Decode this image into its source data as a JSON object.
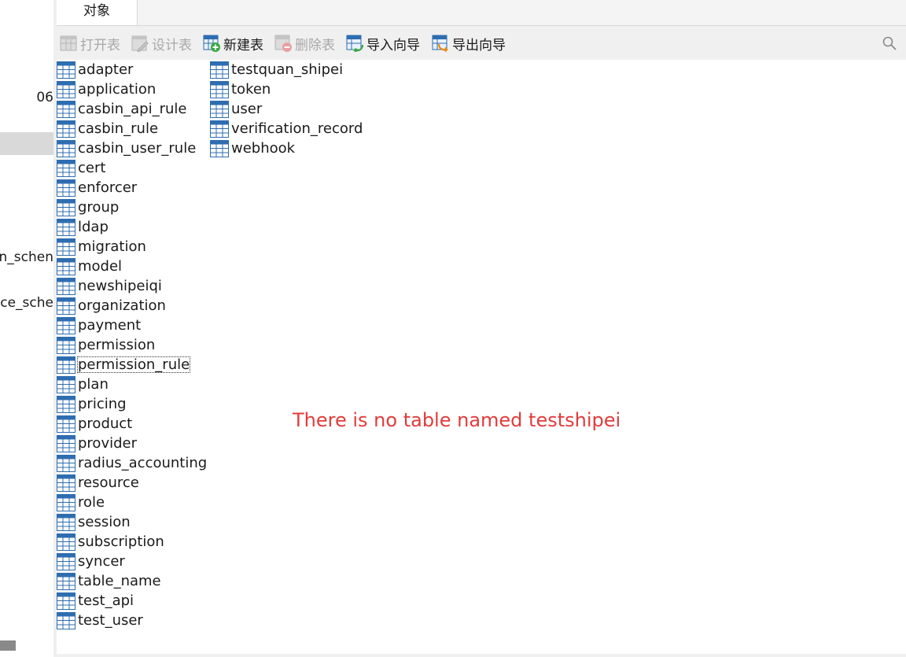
{
  "sidebar": {
    "fragments": [
      "06",
      "n_schen",
      "ce_sche"
    ]
  },
  "tabs": [
    {
      "label": "对象"
    }
  ],
  "toolbar": {
    "open_table": "打开表",
    "design_table": "设计表",
    "new_table": "新建表",
    "delete_table": "删除表",
    "import_wizard": "导入向导",
    "export_wizard": "导出向导"
  },
  "tables": {
    "column1": [
      "adapter",
      "application",
      "casbin_api_rule",
      "casbin_rule",
      "casbin_user_rule",
      "cert",
      "enforcer",
      "group",
      "ldap",
      "migration",
      "model",
      "newshipeiqi",
      "organization",
      "payment",
      "permission",
      "permission_rule",
      "plan",
      "pricing",
      "product",
      "provider",
      "radius_accounting",
      "resource",
      "role",
      "session",
      "subscription",
      "syncer",
      "table_name",
      "test_api",
      "test_user"
    ],
    "column2": [
      "testquan_shipei",
      "token",
      "user",
      "verification_record",
      "webhook"
    ],
    "focused": "permission_rule"
  },
  "annotation": "There is no table named testshipei",
  "colors": {
    "table_icon": "#2e6db0",
    "annotation": "#e23b3b",
    "add_badge": "#3aa845",
    "arrow_badge": "#e88a1a"
  }
}
